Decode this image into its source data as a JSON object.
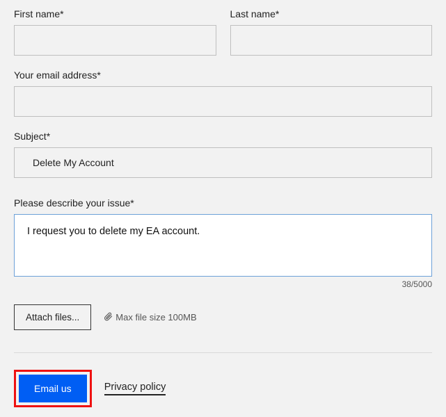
{
  "form": {
    "first_name": {
      "label": "First name*",
      "value": ""
    },
    "last_name": {
      "label": "Last name*",
      "value": ""
    },
    "email": {
      "label": "Your email address*",
      "value": ""
    },
    "subject": {
      "label": "Subject*",
      "value": "Delete My Account"
    },
    "description": {
      "label": "Please describe your issue*",
      "value": "I request you to delete my EA account.",
      "counter": "38/5000"
    },
    "attach": {
      "button_label": "Attach files...",
      "max_size_label": "Max file size 100MB"
    },
    "submit": {
      "label": "Email us"
    },
    "privacy": {
      "label": "Privacy policy"
    }
  }
}
